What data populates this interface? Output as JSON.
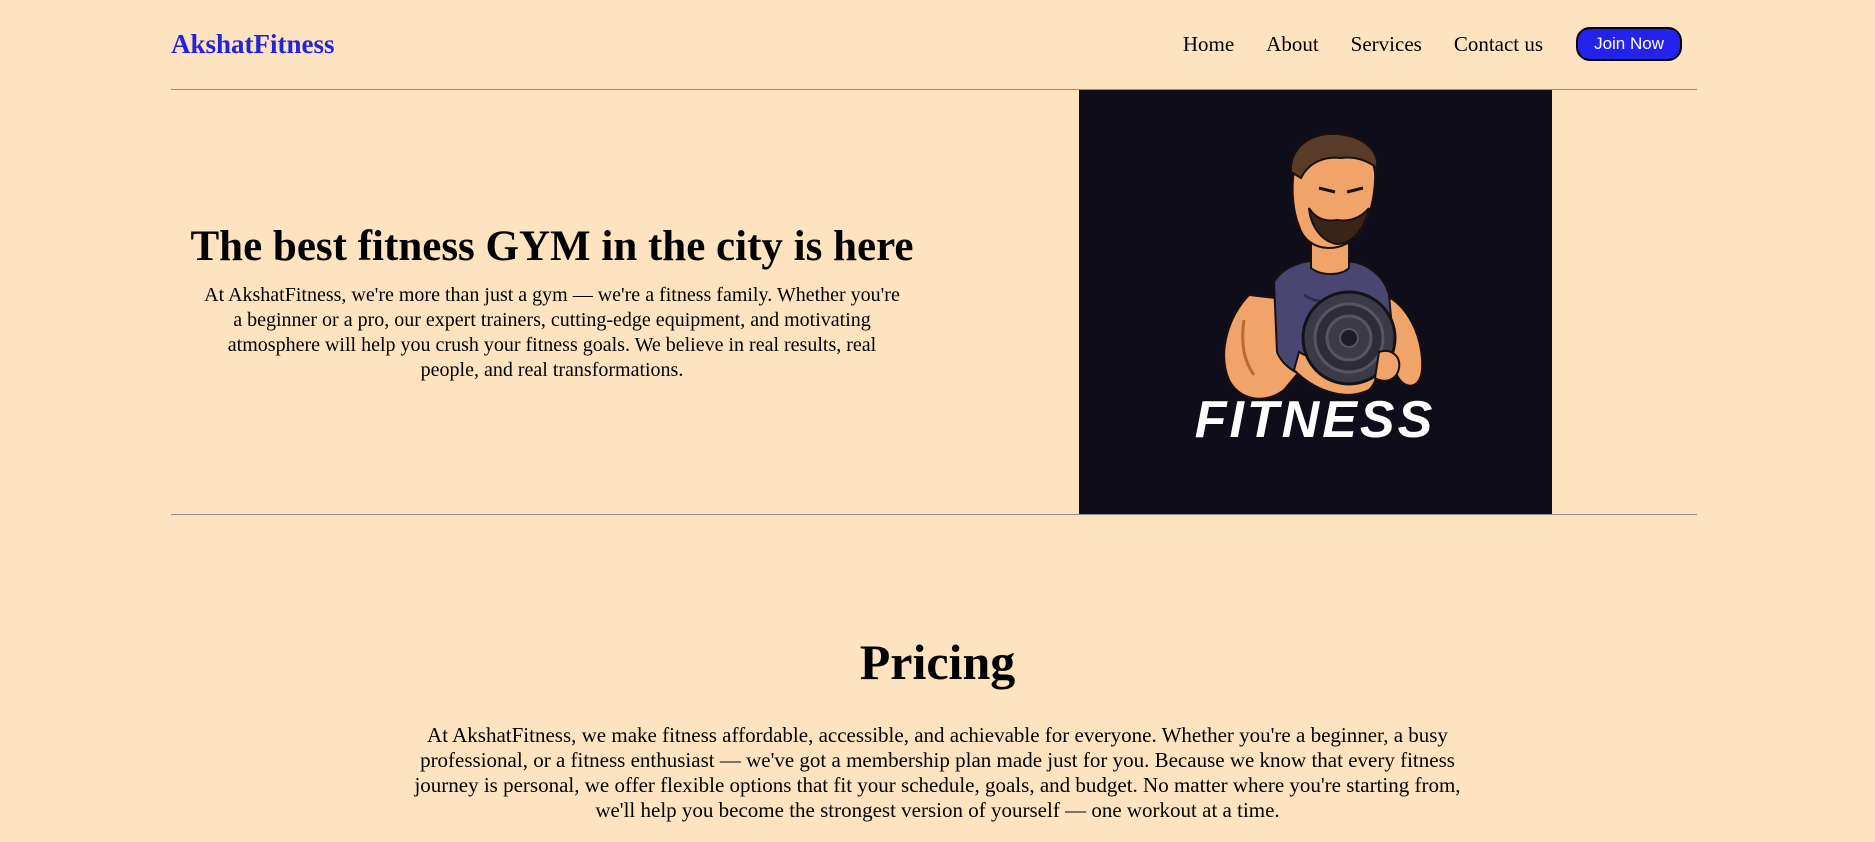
{
  "brand": {
    "name": "AkshatFitness",
    "color": "#2323dc"
  },
  "nav": {
    "items": [
      {
        "label": "Home"
      },
      {
        "label": "About"
      },
      {
        "label": "Services"
      },
      {
        "label": "Contact us"
      }
    ],
    "cta_label": "Join Now"
  },
  "hero": {
    "title": "The best fitness GYM in the city is here",
    "description": "At AkshatFitness, we're more than just a gym — we're a fitness family. Whether you're a beginner or a pro, our expert trainers, cutting-edge equipment, and motivating atmosphere will help you crush your fitness goals. We believe in real results, real people, and real transformations.",
    "image": {
      "logo_text": "FITNESS",
      "icon": "bodybuilder-dumbbell-icon",
      "background": "#0f0d19"
    }
  },
  "pricing": {
    "title": "Pricing",
    "description": "At AkshatFitness, we make fitness affordable, accessible, and achievable for everyone. Whether you're a beginner, a busy professional, or a fitness enthusiast — we've got a membership plan made just for you. Because we know that every fitness journey is personal, we offer flexible options that fit your schedule, goals, and budget. No matter where you're starting from, we'll help you become the strongest version of yourself — one workout at a time."
  },
  "colors": {
    "page_background": "#fde3c0",
    "cta_background": "#2323ec",
    "divider": "#8d8d8d"
  }
}
